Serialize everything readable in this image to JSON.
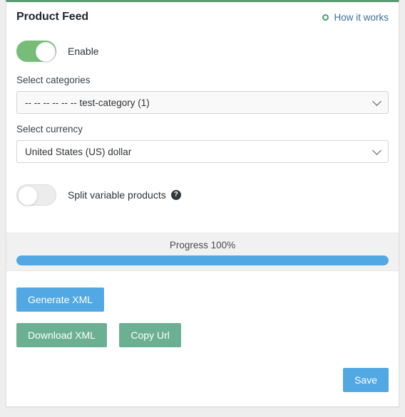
{
  "header": {
    "title": "Product Feed",
    "help_link": "How it works",
    "help_icon": "ring-icon"
  },
  "enable": {
    "label": "Enable",
    "state": "on"
  },
  "categories": {
    "label": "Select categories",
    "value": "-- -- -- -- -- -- test-category (1)"
  },
  "currency": {
    "label": "Select currency",
    "value": "United States (US) dollar"
  },
  "split": {
    "label": "Split variable products",
    "state": "off",
    "help_icon": "?"
  },
  "progress": {
    "label": "Progress 100%",
    "percent": 100
  },
  "buttons": {
    "generate": "Generate XML",
    "download": "Download XML",
    "copy": "Copy Url",
    "save": "Save"
  },
  "colors": {
    "accent_green": "#5b9a72",
    "toggle_on": "#77bd77",
    "blue": "#52a8e2",
    "green_button": "#6bb093",
    "link": "#3c6e99"
  }
}
